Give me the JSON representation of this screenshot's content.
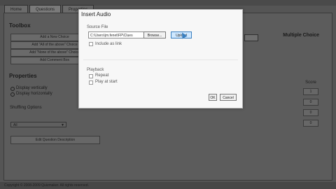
{
  "tabs": [
    "Home",
    "Questions",
    "Properties"
  ],
  "toolbox": {
    "title": "Toolbox",
    "buttons": [
      "Add a New Choice",
      "Add \"All of the above\" Choice",
      "Add \"None of the above\" Choice",
      "Add Comment Box"
    ]
  },
  "properties": {
    "title": "Properties",
    "display_vertically": "Display vertically",
    "display_horizontally": "Display horizontally",
    "shuffling_label": "Shuffling Options",
    "shuffling_value": "All",
    "edit_description": "Edit Question Description"
  },
  "right_panel": {
    "header": "Multiple Choice",
    "score_label": "Score",
    "scores": [
      "1",
      "0",
      "0",
      "0"
    ]
  },
  "footer": {
    "text": "Copyright © 2008-2009 Quizmaker. All rights reserved."
  },
  "dialog": {
    "title": "Insert Audio",
    "source_label": "Source File",
    "source_value": "C:\\Users\\jm.fenet\\FP\\Clues",
    "browse_label": "Browse...",
    "upload_label": "Upload",
    "include_as_link": "Include as link",
    "playback_label": "Playback",
    "repeat_label": "Repeat",
    "play_at_start_label": "Play at start",
    "ok_label": "OK",
    "cancel_label": "Cancel"
  }
}
